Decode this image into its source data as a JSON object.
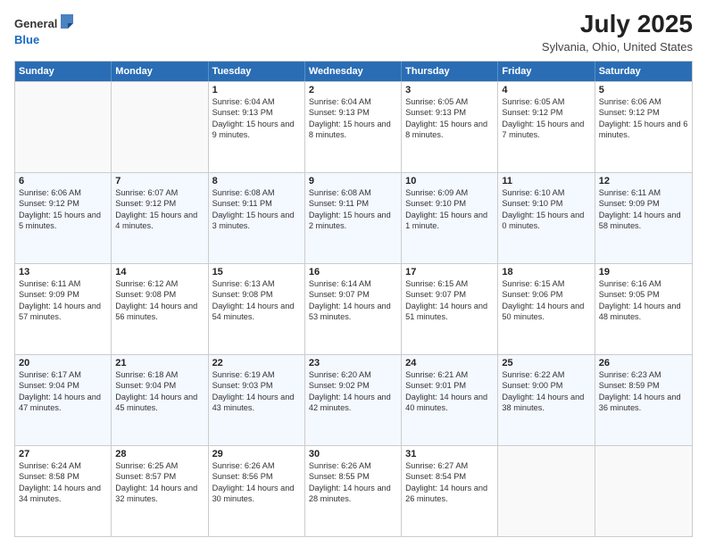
{
  "logo": {
    "general": "General",
    "blue": "Blue"
  },
  "title": "July 2025",
  "subtitle": "Sylvania, Ohio, United States",
  "days_of_week": [
    "Sunday",
    "Monday",
    "Tuesday",
    "Wednesday",
    "Thursday",
    "Friday",
    "Saturday"
  ],
  "weeks": [
    [
      {
        "day": "",
        "detail": ""
      },
      {
        "day": "",
        "detail": ""
      },
      {
        "day": "1",
        "detail": "Sunrise: 6:04 AM\nSunset: 9:13 PM\nDaylight: 15 hours\nand 9 minutes."
      },
      {
        "day": "2",
        "detail": "Sunrise: 6:04 AM\nSunset: 9:13 PM\nDaylight: 15 hours\nand 8 minutes."
      },
      {
        "day": "3",
        "detail": "Sunrise: 6:05 AM\nSunset: 9:13 PM\nDaylight: 15 hours\nand 8 minutes."
      },
      {
        "day": "4",
        "detail": "Sunrise: 6:05 AM\nSunset: 9:12 PM\nDaylight: 15 hours\nand 7 minutes."
      },
      {
        "day": "5",
        "detail": "Sunrise: 6:06 AM\nSunset: 9:12 PM\nDaylight: 15 hours\nand 6 minutes."
      }
    ],
    [
      {
        "day": "6",
        "detail": "Sunrise: 6:06 AM\nSunset: 9:12 PM\nDaylight: 15 hours\nand 5 minutes."
      },
      {
        "day": "7",
        "detail": "Sunrise: 6:07 AM\nSunset: 9:12 PM\nDaylight: 15 hours\nand 4 minutes."
      },
      {
        "day": "8",
        "detail": "Sunrise: 6:08 AM\nSunset: 9:11 PM\nDaylight: 15 hours\nand 3 minutes."
      },
      {
        "day": "9",
        "detail": "Sunrise: 6:08 AM\nSunset: 9:11 PM\nDaylight: 15 hours\nand 2 minutes."
      },
      {
        "day": "10",
        "detail": "Sunrise: 6:09 AM\nSunset: 9:10 PM\nDaylight: 15 hours\nand 1 minute."
      },
      {
        "day": "11",
        "detail": "Sunrise: 6:10 AM\nSunset: 9:10 PM\nDaylight: 15 hours\nand 0 minutes."
      },
      {
        "day": "12",
        "detail": "Sunrise: 6:11 AM\nSunset: 9:09 PM\nDaylight: 14 hours\nand 58 minutes."
      }
    ],
    [
      {
        "day": "13",
        "detail": "Sunrise: 6:11 AM\nSunset: 9:09 PM\nDaylight: 14 hours\nand 57 minutes."
      },
      {
        "day": "14",
        "detail": "Sunrise: 6:12 AM\nSunset: 9:08 PM\nDaylight: 14 hours\nand 56 minutes."
      },
      {
        "day": "15",
        "detail": "Sunrise: 6:13 AM\nSunset: 9:08 PM\nDaylight: 14 hours\nand 54 minutes."
      },
      {
        "day": "16",
        "detail": "Sunrise: 6:14 AM\nSunset: 9:07 PM\nDaylight: 14 hours\nand 53 minutes."
      },
      {
        "day": "17",
        "detail": "Sunrise: 6:15 AM\nSunset: 9:07 PM\nDaylight: 14 hours\nand 51 minutes."
      },
      {
        "day": "18",
        "detail": "Sunrise: 6:15 AM\nSunset: 9:06 PM\nDaylight: 14 hours\nand 50 minutes."
      },
      {
        "day": "19",
        "detail": "Sunrise: 6:16 AM\nSunset: 9:05 PM\nDaylight: 14 hours\nand 48 minutes."
      }
    ],
    [
      {
        "day": "20",
        "detail": "Sunrise: 6:17 AM\nSunset: 9:04 PM\nDaylight: 14 hours\nand 47 minutes."
      },
      {
        "day": "21",
        "detail": "Sunrise: 6:18 AM\nSunset: 9:04 PM\nDaylight: 14 hours\nand 45 minutes."
      },
      {
        "day": "22",
        "detail": "Sunrise: 6:19 AM\nSunset: 9:03 PM\nDaylight: 14 hours\nand 43 minutes."
      },
      {
        "day": "23",
        "detail": "Sunrise: 6:20 AM\nSunset: 9:02 PM\nDaylight: 14 hours\nand 42 minutes."
      },
      {
        "day": "24",
        "detail": "Sunrise: 6:21 AM\nSunset: 9:01 PM\nDaylight: 14 hours\nand 40 minutes."
      },
      {
        "day": "25",
        "detail": "Sunrise: 6:22 AM\nSunset: 9:00 PM\nDaylight: 14 hours\nand 38 minutes."
      },
      {
        "day": "26",
        "detail": "Sunrise: 6:23 AM\nSunset: 8:59 PM\nDaylight: 14 hours\nand 36 minutes."
      }
    ],
    [
      {
        "day": "27",
        "detail": "Sunrise: 6:24 AM\nSunset: 8:58 PM\nDaylight: 14 hours\nand 34 minutes."
      },
      {
        "day": "28",
        "detail": "Sunrise: 6:25 AM\nSunset: 8:57 PM\nDaylight: 14 hours\nand 32 minutes."
      },
      {
        "day": "29",
        "detail": "Sunrise: 6:26 AM\nSunset: 8:56 PM\nDaylight: 14 hours\nand 30 minutes."
      },
      {
        "day": "30",
        "detail": "Sunrise: 6:26 AM\nSunset: 8:55 PM\nDaylight: 14 hours\nand 28 minutes."
      },
      {
        "day": "31",
        "detail": "Sunrise: 6:27 AM\nSunset: 8:54 PM\nDaylight: 14 hours\nand 26 minutes."
      },
      {
        "day": "",
        "detail": ""
      },
      {
        "day": "",
        "detail": ""
      }
    ]
  ]
}
